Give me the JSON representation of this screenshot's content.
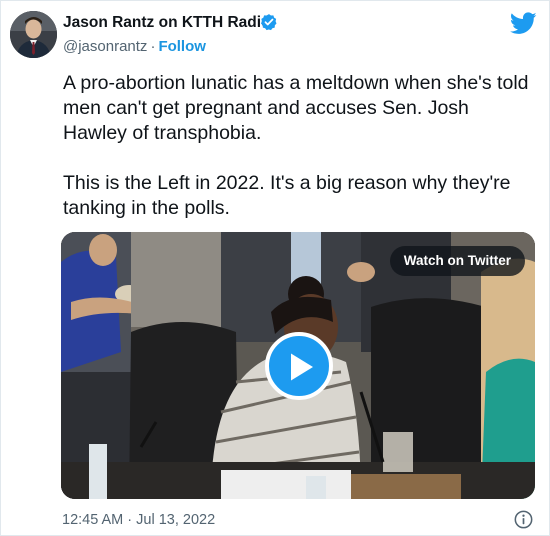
{
  "author": {
    "name": "Jason Rantz on KTTH Radio",
    "handle": "@jasonrantz",
    "separator": "·",
    "follow_label": "Follow",
    "verified_icon": "verified-badge-icon",
    "avatar_icon": "profile-avatar"
  },
  "brand": {
    "logo_icon": "twitter-bird-icon",
    "accent_color": "#1d9bf0",
    "link_color": "#1b95e0"
  },
  "tweet": {
    "paragraphs": [
      "A pro-abortion lunatic has a meltdown when she's told men can't get pregnant and accuses Sen. Josh Hawley of transphobia.",
      "This is the Left in 2022. It's a big reason why they're tanking in the polls."
    ]
  },
  "media": {
    "watch_label": "Watch on Twitter",
    "play_icon": "play-icon"
  },
  "footer": {
    "timestamp": "12:45 AM · Jul 13, 2022",
    "info_icon": "info-icon"
  }
}
